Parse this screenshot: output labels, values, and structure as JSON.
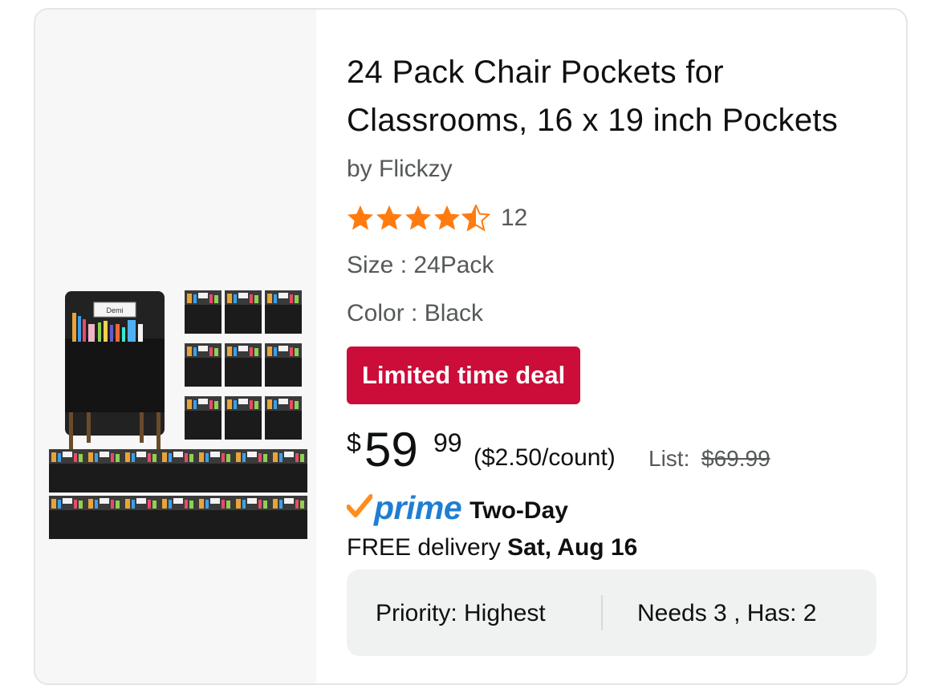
{
  "product": {
    "title": "24 Pack Chair Pockets for Classrooms, 16 x 19 inch Pockets",
    "byline": "by Flickzy",
    "rating": {
      "stars": 4.5,
      "max": 5,
      "count": "12"
    },
    "size": "Size : 24Pack",
    "color": "Color : Black",
    "deal_badge": "Limited time deal",
    "price": {
      "symbol": "$",
      "whole": "59",
      "fraction": "99",
      "unit": "($2.50/count)",
      "list_label": "List:",
      "list_value": "$69.99"
    },
    "prime": {
      "label": "prime",
      "speed": "Two-Day"
    },
    "delivery": {
      "prefix": "FREE delivery",
      "date": "Sat, Aug 16"
    },
    "image": {
      "icon": "chair-pocket-product-image",
      "name_tag": "Demi"
    }
  },
  "info_pill": {
    "priority": "Priority: Highest",
    "needs": "Needs 3 , Has: 2"
  },
  "colors": {
    "deal_red": "#cc0c39",
    "star_orange": "#ff7b10",
    "prime_blue": "#1f7ed3",
    "prime_check": "#ff8d1e",
    "text_primary": "#0f1111",
    "text_secondary": "#565959",
    "pill_background": "#f0f2f2"
  }
}
